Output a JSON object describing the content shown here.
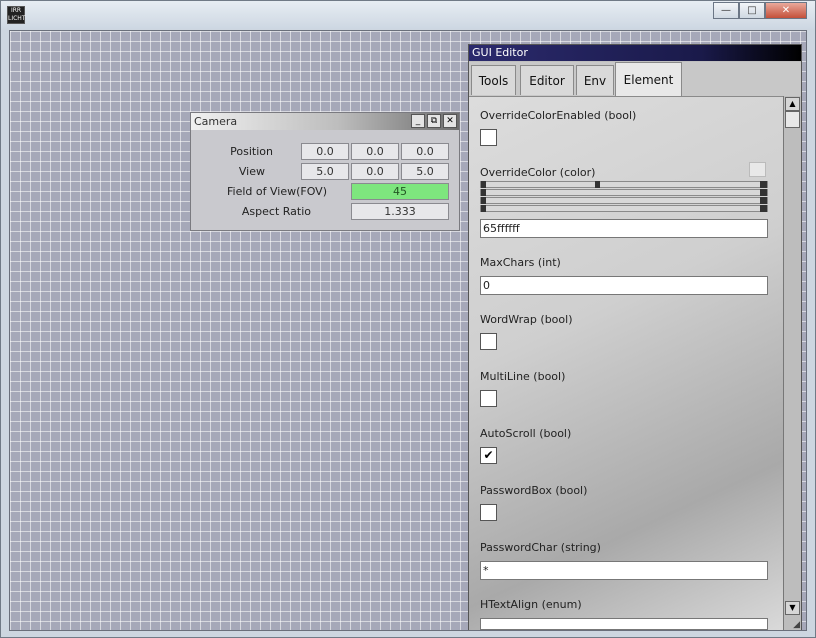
{
  "os_window": {
    "logo_text": "IRR LICHT",
    "minimize_glyph": "—",
    "maximize_glyph": "□",
    "close_glyph": "✕"
  },
  "camera": {
    "title": "Camera",
    "btn_min": "_",
    "btn_restore": "⧉",
    "btn_close": "✕",
    "rows": [
      {
        "label": "Position",
        "values": [
          "0.0",
          "0.0",
          "0.0"
        ]
      },
      {
        "label": "View",
        "values": [
          "5.0",
          "0.0",
          "5.0"
        ]
      },
      {
        "label": "Field of View(FOV)",
        "value": "45"
      },
      {
        "label": "Aspect Ratio",
        "value": "1.333"
      }
    ]
  },
  "gui_editor": {
    "title": "GUI Editor",
    "tabs": [
      "Tools",
      "Editor",
      "Env",
      "Element"
    ],
    "active_tab": "Element",
    "properties": {
      "override_color_enabled": {
        "label": "OverrideColorEnabled (bool)",
        "checked": false
      },
      "override_color": {
        "label": "OverrideColor (color)",
        "value": "65ffffff",
        "sliders": [
          0.4,
          1.0,
          1.0,
          1.0
        ]
      },
      "max_chars": {
        "label": "MaxChars (int)",
        "value": "0"
      },
      "word_wrap": {
        "label": "WordWrap (bool)",
        "checked": false
      },
      "multi_line": {
        "label": "MultiLine (bool)",
        "checked": false
      },
      "auto_scroll": {
        "label": "AutoScroll (bool)",
        "checked": true,
        "check_glyph": "✔"
      },
      "password_box": {
        "label": "PasswordBox (bool)",
        "checked": false
      },
      "password_char": {
        "label": "PasswordChar (string)",
        "value": "*"
      },
      "h_text_align": {
        "label": "HTextAlign (enum)"
      }
    },
    "scrollbar": {
      "up_glyph": "▲",
      "down_glyph": "▼",
      "grip_glyph": "◢"
    }
  },
  "colors": {
    "fov_field": "#7ee67e",
    "editor_title": "#2b2a6d",
    "grid_bg": "#a6a8b9"
  }
}
